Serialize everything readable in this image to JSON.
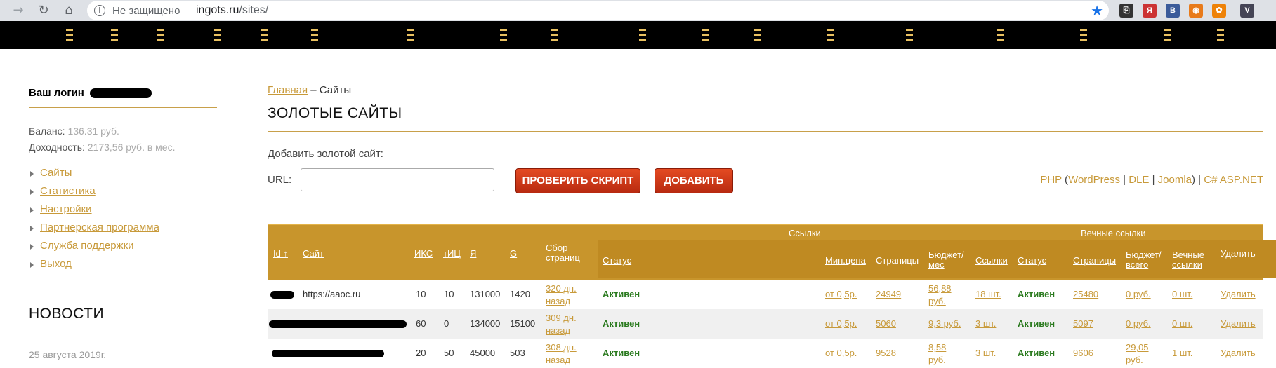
{
  "browser": {
    "not_secure": "Не защищено",
    "url_host": "ingots.ru",
    "url_path": "/sites/"
  },
  "sidebar": {
    "login_label": "Ваш логин",
    "balance_label": "Баланс:",
    "balance_value": "136.31 руб.",
    "income_label": "Доходность:",
    "income_value": "2173,56 руб. в мес.",
    "menu": [
      "Сайты",
      "Статистика",
      "Настройки",
      "Партнерская программа",
      "Служба поддержки",
      "Выход"
    ],
    "news_title": "НОВОСТИ",
    "news_date": "25 августа 2019г."
  },
  "main": {
    "breadcrumb_home": "Главная",
    "breadcrumb_sep": "–",
    "breadcrumb_current": "Сайты",
    "title": "ЗОЛОТЫЕ САЙТЫ",
    "add_label": "Добавить золотой сайт:",
    "url_label": "URL:",
    "check_button": "ПРОВЕРИТЬ СКРИПТ",
    "add_button": "ДОБАВИТЬ",
    "platforms": {
      "php": "PHP",
      "wordpress": "WordPress",
      "dle": "DLE",
      "joomla": "Joomla",
      "csharp": "C# ASP.NET"
    }
  },
  "table": {
    "group_links": "Ссылки",
    "group_eternal": "Вечные ссылки",
    "headers": {
      "id": "Id ↑",
      "site": "Сайт",
      "iks": "ИКС",
      "tic": "тИЦ",
      "ya": "Я",
      "g": "G",
      "collect": "Сбор страниц",
      "status": "Статус",
      "min_price": "Мин.цена",
      "pages": "Страницы",
      "budget": "Бюджет/ мес",
      "links": "Ссылки",
      "e_status": "Статус",
      "e_pages": "Страницы",
      "e_budget": "Бюджет/ всего",
      "e_links": "Вечные ссылки",
      "delete": "Удалить"
    },
    "rows": [
      {
        "site": "https://aaoc.ru",
        "iks": "10",
        "tic": "10",
        "ya": "131000",
        "g": "1420",
        "collect": "320 дн. назад",
        "status": "Активен",
        "min_price": "от 0,5р.",
        "pages": "24949",
        "budget": "56,88 руб.",
        "links": "18 шт.",
        "e_status": "Активен",
        "e_pages": "25480",
        "e_budget": "0 руб.",
        "e_links": "0 шт.",
        "delete": "Удалить"
      },
      {
        "site": "",
        "iks": "60",
        "tic": "0",
        "ya": "134000",
        "g": "15100",
        "collect": "309 дн. назад",
        "status": "Активен",
        "min_price": "от 0,5р.",
        "pages": "5060",
        "budget": "9,3 руб.",
        "links": "3 шт.",
        "e_status": "Активен",
        "e_pages": "5097",
        "e_budget": "0 руб.",
        "e_links": "0 шт.",
        "delete": "Удалить"
      },
      {
        "site": "",
        "iks": "20",
        "tic": "50",
        "ya": "45000",
        "g": "503",
        "collect": "308 дн. назад",
        "status": "Активен",
        "min_price": "от 0,5р.",
        "pages": "9528",
        "budget": "8,58 руб.",
        "links": "3 шт.",
        "e_status": "Активен",
        "e_pages": "9606",
        "e_budget": "29,05 руб.",
        "e_links": "1 шт.",
        "delete": "Удалить"
      }
    ]
  },
  "colors": {
    "gold_link": "#c89a3a",
    "table_header": "#c8952c",
    "active_green": "#2a7a1e",
    "button_red": "#d03a18"
  }
}
